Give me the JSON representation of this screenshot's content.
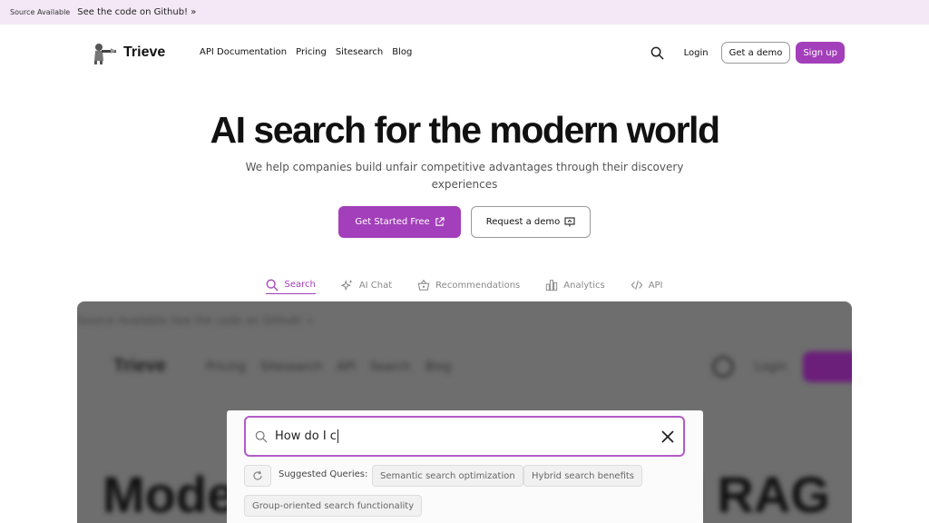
{
  "banner": {
    "tag": "Source Available",
    "link": "See the code on Github! »"
  },
  "nav": {
    "brand": "Trieve",
    "links": [
      "API Documentation",
      "Pricing",
      "Sitesearch",
      "Blog"
    ],
    "login": "Login",
    "demo": "Get a demo",
    "signup": "Sign up"
  },
  "hero": {
    "title": "AI search for the modern world",
    "subtitle": "We help companies build unfair competitive advantages through their discovery experiences",
    "primary_cta": "Get Started Free",
    "secondary_cta": "Request a demo"
  },
  "tabs": [
    {
      "label": "Search",
      "icon": "search-icon",
      "active": true
    },
    {
      "label": "AI Chat",
      "icon": "sparkles-icon",
      "active": false
    },
    {
      "label": "Recommendations",
      "icon": "basket-icon",
      "active": false
    },
    {
      "label": "Analytics",
      "icon": "bar-chart-icon",
      "active": false
    },
    {
      "label": "API",
      "icon": "code-icon",
      "active": false
    }
  ],
  "preview": {
    "bg_banner": "Source Available  See the code on Github! »",
    "bg_brand": "Trieve",
    "bg_nav": "Pricing Sitesearch API Search Blog",
    "bg_login": "Login",
    "bg_hero_left": "Mode",
    "bg_hero_right": "d RAG",
    "search_value": "How do I c",
    "suggested_label": "Suggested Queries:",
    "suggestions": [
      "Semantic search optimization",
      "Hybrid search benefits",
      "Group-oriented search functionality"
    ]
  },
  "colors": {
    "accent": "#a33fba",
    "banner_bg": "#f4e8f6"
  }
}
